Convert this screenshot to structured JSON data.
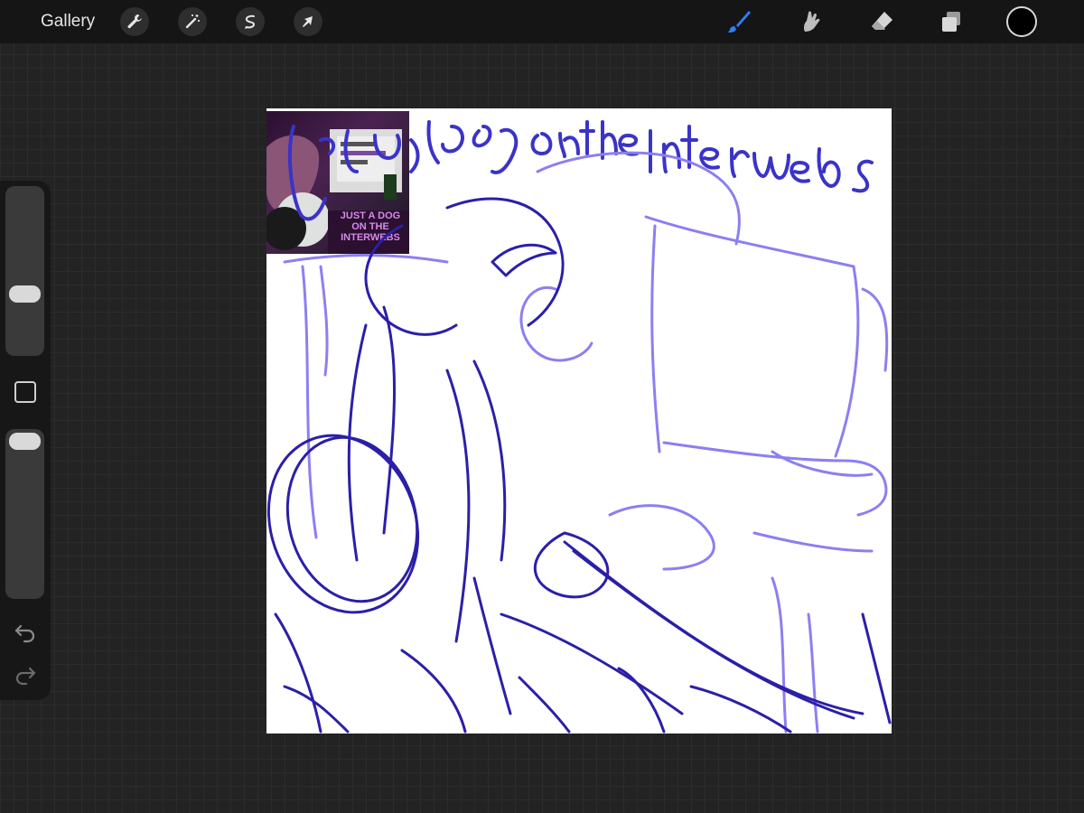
{
  "topbar": {
    "gallery_label": "Gallery",
    "left_tools": [
      "wrench-icon",
      "magic-wand-icon",
      "selection-icon",
      "transform-arrow-icon"
    ],
    "right_tools": [
      "brush-icon",
      "smudge-icon",
      "eraser-icon",
      "layers-icon"
    ],
    "active_tool": "brush-icon",
    "accent_color": "#2f7ff5",
    "current_color": "#000000"
  },
  "sidebar": {
    "brush_size_level": 0.55,
    "opacity_level": 0.02,
    "controls": [
      "brush-size-slider",
      "modify-button",
      "opacity-slider",
      "undo-icon",
      "redo-icon"
    ]
  },
  "canvas": {
    "background_color": "#ffffff",
    "sketch_colors": [
      "#2b1fa8",
      "#3b33c8",
      "#8c7ff0"
    ],
    "reference_image_text": [
      "JUST A DOG",
      "ON THE",
      "INTERWEBS"
    ]
  }
}
